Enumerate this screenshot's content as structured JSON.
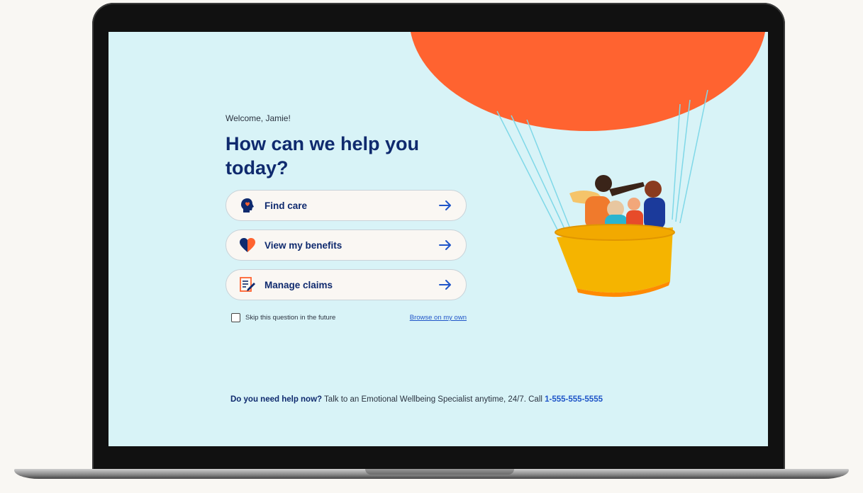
{
  "welcome_text": "Welcome, Jamie!",
  "headline": "How can we help you today?",
  "options": [
    {
      "label": "Find care",
      "icon": "head-heart-icon"
    },
    {
      "label": "View my benefits",
      "icon": "heart-icon"
    },
    {
      "label": "Manage claims",
      "icon": "claim-form-icon"
    }
  ],
  "skip_label": "Skip this question in the future",
  "browse_link": "Browse on my own",
  "help": {
    "question": "Do you need help now?",
    "text": " Talk to an Emotional Wellbeing Specialist anytime, 24/7. Call ",
    "phone": "1-555-555-5555"
  },
  "colors": {
    "screen_bg": "#d8f3f7",
    "primary_navy": "#0f2a6e",
    "balloon_orange": "#ff6330",
    "basket_yellow": "#f5b400",
    "link_blue": "#1f55c8"
  }
}
